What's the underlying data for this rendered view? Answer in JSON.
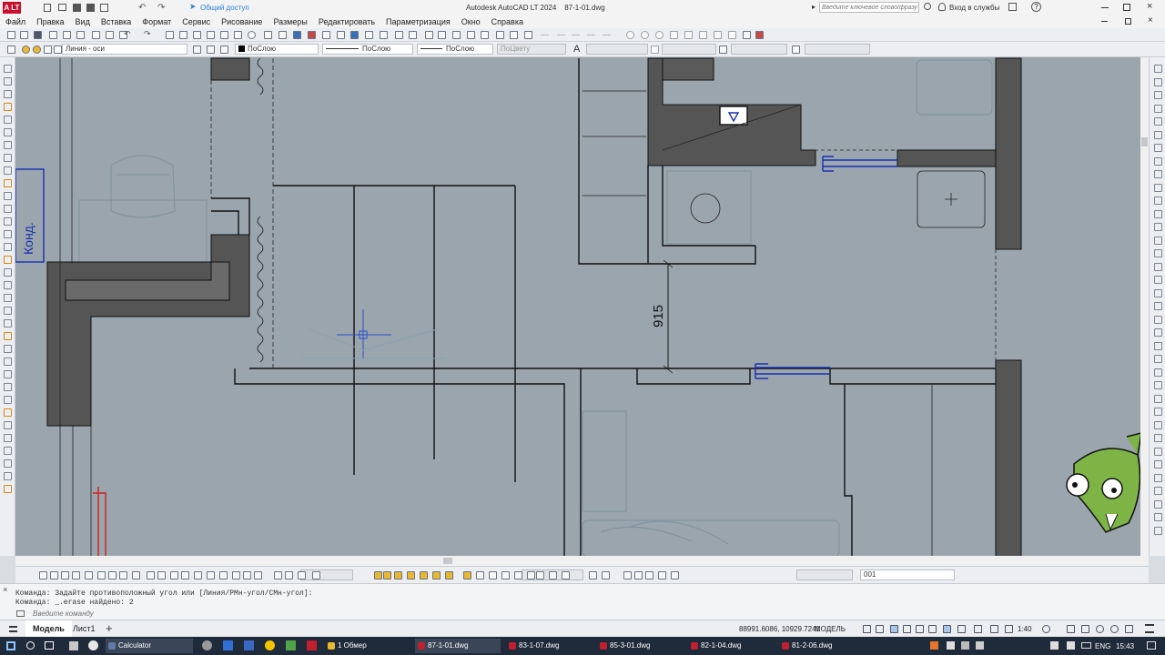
{
  "app": {
    "logo": "A LT",
    "quick_access": "Общий доступ",
    "title": "Autodesk AutoCAD LT 2024    87-1-01.dwg",
    "search_placeholder": "Введите ключевое слово/фразу",
    "sign_in": "Вход в службы",
    "help": "?"
  },
  "menu": [
    "Файл",
    "Правка",
    "Вид",
    "Вставка",
    "Формат",
    "Сервис",
    "Рисование",
    "Размеры",
    "Редактировать",
    "Параметризация",
    "Окно",
    "Справка"
  ],
  "properties": {
    "layer": "Линия - оси",
    "color": "ПоСлою",
    "linetype": "ПоСлою",
    "lineweight": "ПоСлою",
    "plotstyle": "ПоЦвету",
    "text_style_icon": "A"
  },
  "drawing": {
    "dimension_text": "915",
    "label_text": "Конд."
  },
  "bottom_toolbar": {
    "dimstyle": "001"
  },
  "command_line": {
    "line1": "Команда: Задайте противоположный угол или [Линия/РМн-угол/СМн-угол]:",
    "line2": "Команда: _.erase найдено: 2",
    "placeholder": "Введите команду"
  },
  "layout_tabs": [
    "Модель",
    "Лист1"
  ],
  "status": {
    "coords": "88991.6086, 10929.7241",
    "space": "МОДЕЛЬ",
    "scale": "1:40"
  },
  "taskbar": {
    "apps": [
      "Calculator",
      "1 Обмер",
      "87-1-01.dwg",
      "83-1-07.dwg",
      "85-3-01.dwg",
      "82-1-04.dwg",
      "81-2-06.dwg"
    ],
    "lang": "ENG",
    "time": "15:43"
  }
}
